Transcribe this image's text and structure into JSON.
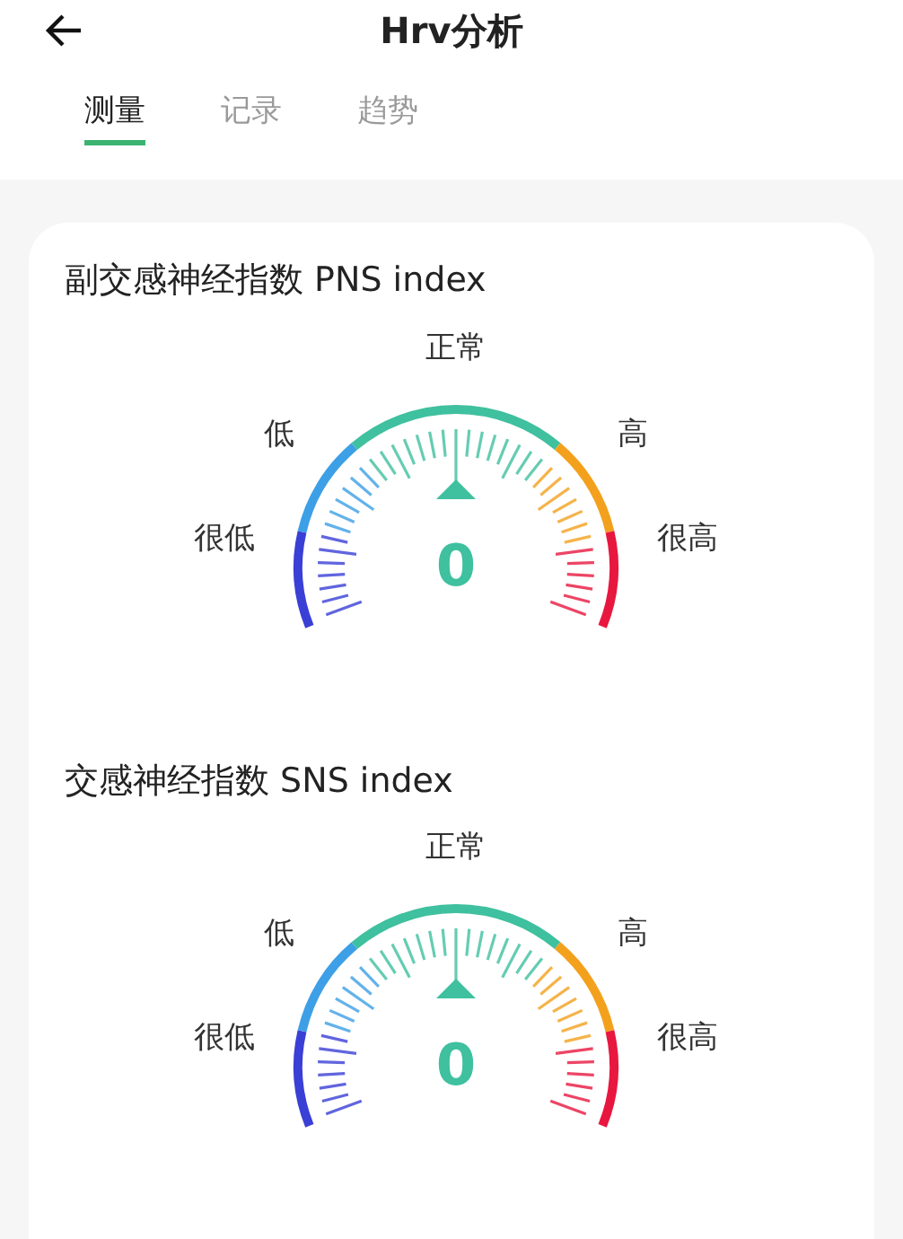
{
  "header": {
    "title": "Hrv分析"
  },
  "tabs": [
    {
      "label": "测量",
      "selected": true
    },
    {
      "label": "记录",
      "selected": false
    },
    {
      "label": "趋势",
      "selected": false
    }
  ],
  "gauges": [
    {
      "title": "副交感神经指数 PNS index",
      "value": "0",
      "bands": [
        {
          "label": "很低",
          "color": "#3a3fd6"
        },
        {
          "label": "低",
          "color": "#3d9fe6"
        },
        {
          "label": "正常",
          "color": "#3fc09f"
        },
        {
          "label": "高",
          "color": "#f3a11d"
        },
        {
          "label": "很高",
          "color": "#e8173f"
        }
      ]
    },
    {
      "title": "交感神经指数 SNS index",
      "value": "0",
      "bands": [
        {
          "label": "很低",
          "color": "#3a3fd6"
        },
        {
          "label": "低",
          "color": "#3d9fe6"
        },
        {
          "label": "正常",
          "color": "#3fc09f"
        },
        {
          "label": "高",
          "color": "#f3a11d"
        },
        {
          "label": "很高",
          "color": "#e8173f"
        }
      ]
    }
  ]
}
